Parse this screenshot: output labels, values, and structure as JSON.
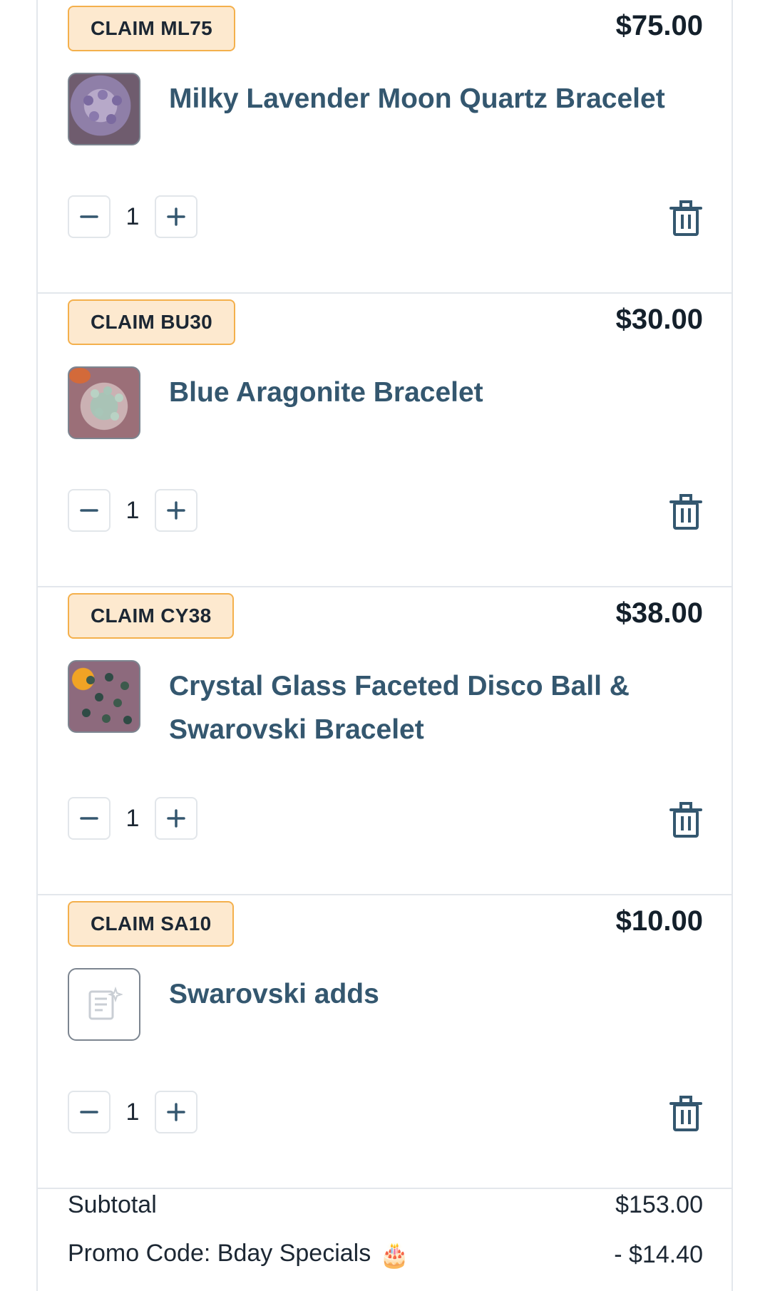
{
  "items": [
    {
      "claim": "CLAIM ML75",
      "price": "$75.00",
      "title": "Milky Lavender Moon Quartz Bracelet",
      "qty": "1",
      "thumb": "lavender-bracelet-photo"
    },
    {
      "claim": "CLAIM BU30",
      "price": "$30.00",
      "title": "Blue Aragonite Bracelet",
      "qty": "1",
      "thumb": "blue-aragonite-photo"
    },
    {
      "claim": "CLAIM CY38",
      "price": "$38.00",
      "title": "Crystal Glass Faceted Disco Ball & Swarovski Bracelet",
      "qty": "1",
      "thumb": "disco-ball-photo"
    },
    {
      "claim": "CLAIM SA10",
      "price": "$10.00",
      "title": "Swarovski adds",
      "qty": "1",
      "thumb": "placeholder-image-icon"
    }
  ],
  "summary": {
    "subtotal_label": "Subtotal",
    "subtotal_value": "$153.00",
    "promo_label": "Promo Code: Bday Specials",
    "promo_emoji": "🎂",
    "promo_value": "- $14.40"
  },
  "colors": {
    "claim_bg": "#fde9cf",
    "claim_border": "#f4b04c",
    "title": "#34576f",
    "icon": "#34576f"
  },
  "icons": {
    "minus": "minus-icon",
    "plus": "plus-icon",
    "delete": "trash-icon"
  }
}
